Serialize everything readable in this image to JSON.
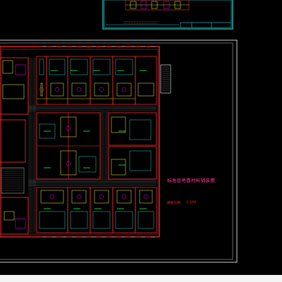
{
  "drawing": {
    "title_block_label": "□□□□□□□□□□□□",
    "plan_title": "标准层地面材料铺装图",
    "scale_label": "图纸比例",
    "scale_value": "1:100",
    "colors": {
      "background": "#000000",
      "frame": "#ffffff",
      "walls": "#ff3030",
      "furniture": "#ffff33",
      "accent": "#ff00ff",
      "secondary": "#33ffff",
      "elevator": "#00ff66",
      "status_bar": "#f4f4f4"
    }
  }
}
